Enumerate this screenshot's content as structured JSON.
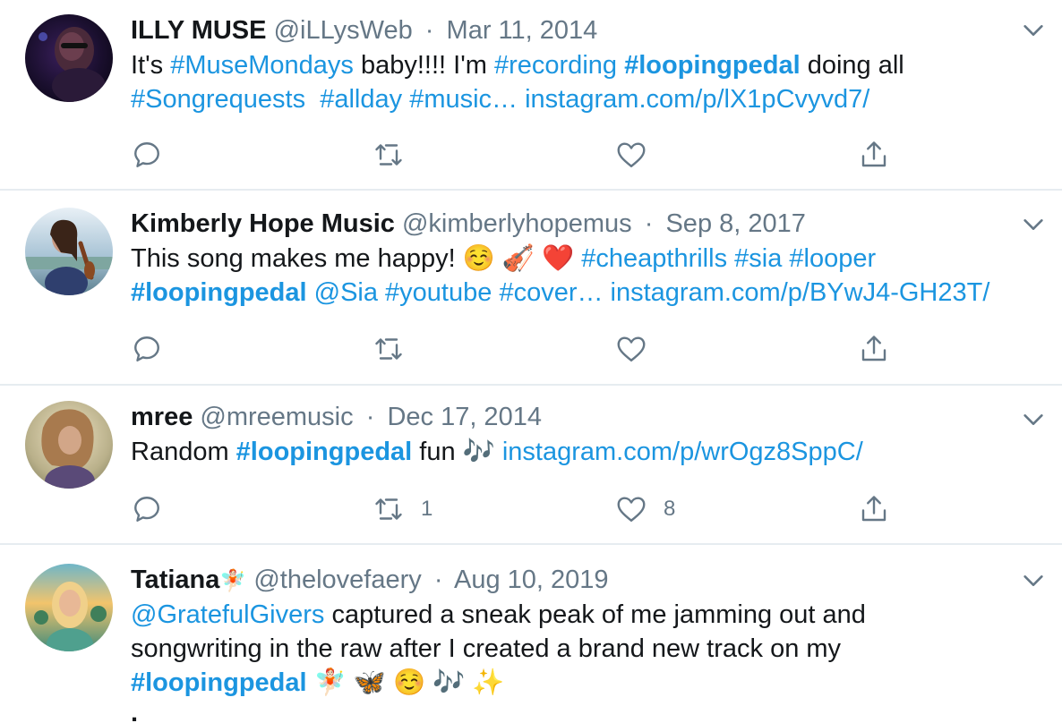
{
  "tweets": [
    {
      "name": "ILLY MUSE",
      "handle": "@iLLysWeb",
      "separator": "·",
      "date": "Mar 11, 2014",
      "line1": {
        "p1": "It's ",
        "tag1": "#MuseMondays",
        "p2": " baby!!!! I'm ",
        "tag2": "#recording",
        "p3": " ",
        "tag3": "#loopingpedal",
        "p4": " doing all"
      },
      "line2": {
        "tag1": "#Songrequests",
        "gap1": "  ",
        "tag2": "#allday",
        "gap2": " ",
        "tag3": "#music…",
        "gap3": " ",
        "url": "instagram.com/p/lX1pCvyvd7/"
      },
      "retweets": "",
      "likes": ""
    },
    {
      "name": "Kimberly Hope Music",
      "handle": "@kimberlyhopemus",
      "separator": "·",
      "date": "Sep 8, 2017",
      "line1": {
        "p1": "This song makes me happy! ",
        "emojis": "☺️ 🎻 ❤️",
        "p2": " ",
        "tag1": "#cheapthrills",
        "p3": " ",
        "tag2": "#sia",
        "p4": " ",
        "tag3": "#looper"
      },
      "line2": {
        "tag1": "#loopingpedal",
        "gap1": " ",
        "mention": "@Sia",
        "gap2": " ",
        "tag2": "#youtube",
        "gap3": " ",
        "tag3": "#cover…",
        "gap4": " ",
        "url": "instagram.com/p/BYwJ4-GH23T/"
      },
      "retweets": "",
      "likes": ""
    },
    {
      "name": "mree",
      "handle": "@mreemusic",
      "separator": "·",
      "date": "Dec 17, 2014",
      "line1": {
        "p1": "Random ",
        "tag1": "#loopingpedal",
        "p2": " fun ",
        "emojis": "🎶",
        "p3": " ",
        "url": "instagram.com/p/wrOgz8SppC/"
      },
      "retweets": "1",
      "likes": "8"
    },
    {
      "name": "Tatiana",
      "name_emoji": "🧚🏻",
      "handle": "@thelovefaery",
      "separator": "·",
      "date": "Aug 10, 2019",
      "line1": {
        "mention": "@GratefulGivers",
        "p1": " captured a sneak peak of me jamming out and"
      },
      "line2": {
        "p1": "songwriting in the raw after I created a brand new track on my"
      },
      "line3": {
        "tag1": "#loopingpedal",
        "p1": " ",
        "emojis": "🧚🏻 🦋 ☺️ 🎶 ✨"
      },
      "line4": {
        "p1": "."
      }
    }
  ],
  "colors": {
    "link": "#1b95e0",
    "secondary": "#657786",
    "divider": "#e6ecf0",
    "text": "#14171a"
  }
}
